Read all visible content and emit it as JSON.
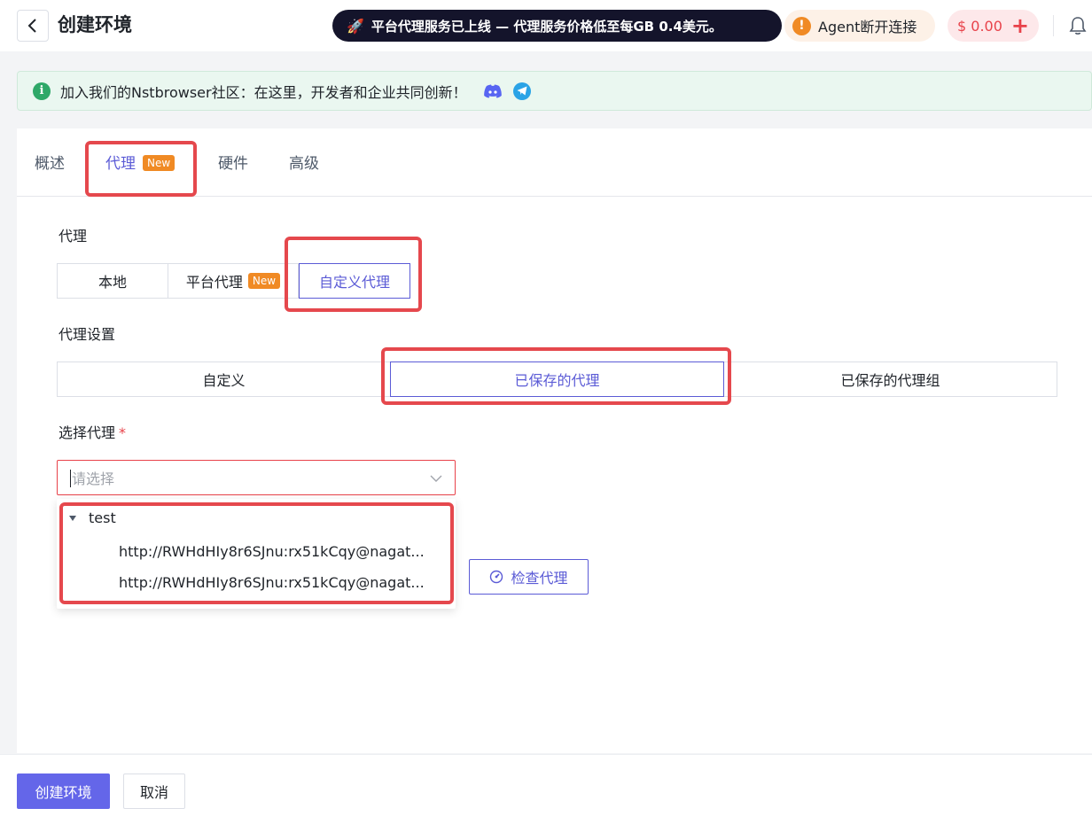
{
  "header": {
    "title": "创建环境",
    "promo_text": "平台代理服务已上线 — 代理服务价格低至每GB 0.4美元。",
    "agent_status": "Agent断开连接",
    "balance": "$ 0.00",
    "balance_add": "+"
  },
  "notice": {
    "text": "加入我们的Nstbrowser社区：在这里，开发者和企业共同创新！"
  },
  "tabs": [
    {
      "label": "概述"
    },
    {
      "label": "代理",
      "badge": "New"
    },
    {
      "label": "硬件"
    },
    {
      "label": "高级"
    }
  ],
  "proxy": {
    "section_label": "代理",
    "options": [
      {
        "label": "本地"
      },
      {
        "label": "平台代理",
        "badge": "New"
      },
      {
        "label": "自定义代理"
      }
    ],
    "settings_label": "代理设置",
    "settings_options": [
      {
        "label": "自定义"
      },
      {
        "label": "已保存的代理"
      },
      {
        "label": "已保存的代理组"
      }
    ],
    "select_label": "选择代理",
    "required_mark": "*",
    "select_placeholder": "请选择",
    "dropdown": {
      "group": "test",
      "items": [
        "http://RWHdHIy8r6SJnu:rx51kCqy@nagat...",
        "http://RWHdHIy8r6SJnu:rx51kCqy@nagat..."
      ]
    },
    "check_button": "检查代理"
  },
  "footer": {
    "create_button": "创建环境",
    "cancel_button": "取消"
  },
  "colors": {
    "accent": "#5b5bd6",
    "primary_button": "#6466e9",
    "highlight": "#e5484d",
    "badge": "#f08a24"
  }
}
